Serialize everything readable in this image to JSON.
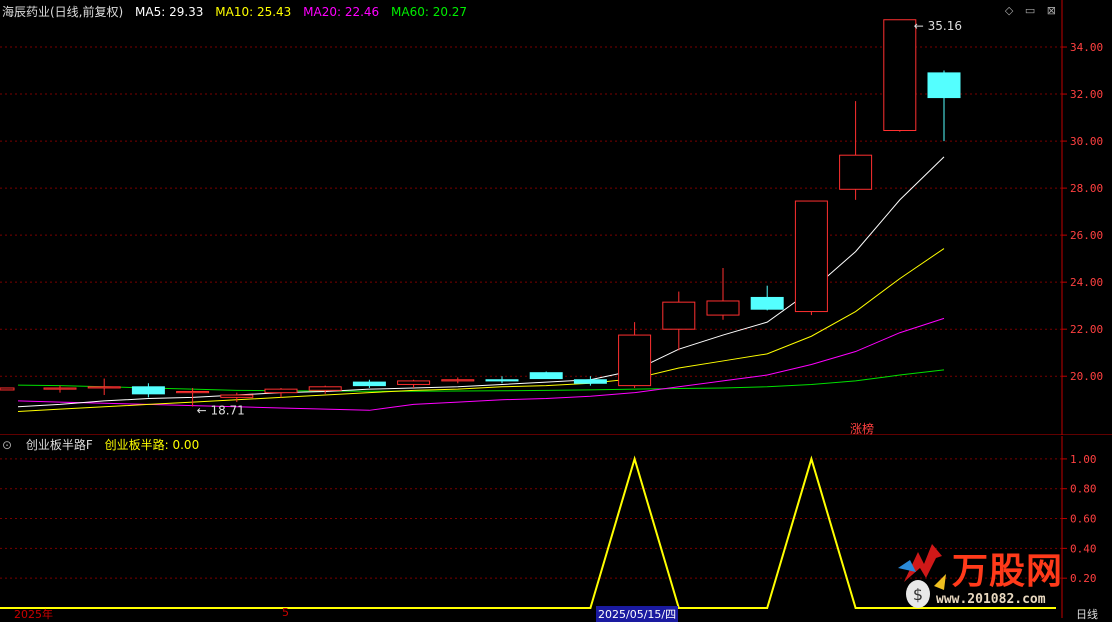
{
  "header": {
    "stock_title": "海辰药业(日线,前复权)",
    "ma": [
      {
        "label": "MA5: 29.33",
        "color": "#ffffff"
      },
      {
        "label": "MA10: 25.43",
        "color": "#ffff00"
      },
      {
        "label": "MA20: 22.46",
        "color": "#ff00ff"
      },
      {
        "label": "MA60: 20.27",
        "color": "#00e000"
      }
    ],
    "icons": [
      "diamond-icon",
      "minimize-icon",
      "close-icon"
    ]
  },
  "indicator": {
    "title": "创业板半路F",
    "value_label": "创业板半路: 0.00",
    "title_color": "#dddddd",
    "value_color": "#ffff00"
  },
  "colors": {
    "up": "#ff3030",
    "down": "#54ffff",
    "grid": "#7a0000",
    "axis": "#c00000",
    "axis_text": "#ff4040",
    "indicator_line": "#ffff00"
  },
  "annotations": {
    "high_label": "35.16",
    "low_label": "18.71",
    "limit_up_tag": "涨榜"
  },
  "bottom": {
    "left_label": "2025年",
    "mid_label": "5",
    "date_label": "2025/05/15/四",
    "right_label": "日线"
  },
  "watermark": {
    "name": "万股网",
    "url": "www.201082.com"
  },
  "chart_data": [
    {
      "type": "candlestick",
      "ylim": [
        17.5,
        36.0
      ],
      "yticks": [
        "20.00",
        "22.00",
        "24.00",
        "26.00",
        "28.00",
        "30.00",
        "32.00",
        "34.00"
      ],
      "ytick_values": [
        20,
        22,
        24,
        26,
        28,
        30,
        32,
        34
      ],
      "candles": [
        {
          "o": 19.45,
          "h": 19.6,
          "l": 19.3,
          "c": 19.5
        },
        {
          "o": 19.5,
          "h": 19.9,
          "l": 19.2,
          "c": 19.55
        },
        {
          "o": 19.55,
          "h": 19.7,
          "l": 19.1,
          "c": 19.25
        },
        {
          "o": 19.3,
          "h": 19.5,
          "l": 18.71,
          "c": 19.35
        },
        {
          "o": 19.1,
          "h": 19.3,
          "l": 18.9,
          "c": 19.2
        },
        {
          "o": 19.3,
          "h": 19.5,
          "l": 19.1,
          "c": 19.45
        },
        {
          "o": 19.4,
          "h": 19.6,
          "l": 19.25,
          "c": 19.55
        },
        {
          "o": 19.75,
          "h": 19.85,
          "l": 19.5,
          "c": 19.6
        },
        {
          "o": 19.65,
          "h": 19.85,
          "l": 19.5,
          "c": 19.8
        },
        {
          "o": 19.8,
          "h": 19.95,
          "l": 19.7,
          "c": 19.85
        },
        {
          "o": 19.85,
          "h": 20.0,
          "l": 19.7,
          "c": 19.8
        },
        {
          "o": 20.15,
          "h": 20.2,
          "l": 19.9,
          "c": 19.9
        },
        {
          "o": 19.85,
          "h": 20.0,
          "l": 19.6,
          "c": 19.7
        },
        {
          "o": 19.6,
          "h": 22.3,
          "l": 19.5,
          "c": 21.75
        },
        {
          "o": 22.0,
          "h": 23.6,
          "l": 21.1,
          "c": 23.15
        },
        {
          "o": 22.6,
          "h": 24.6,
          "l": 22.4,
          "c": 23.2
        },
        {
          "o": 23.35,
          "h": 23.85,
          "l": 22.8,
          "c": 22.85
        },
        {
          "o": 22.75,
          "h": 27.45,
          "l": 22.6,
          "c": 27.45
        },
        {
          "o": 27.95,
          "h": 31.7,
          "l": 27.5,
          "c": 29.4
        },
        {
          "o": 30.45,
          "h": 35.16,
          "l": 30.4,
          "c": 35.16
        },
        {
          "o": 32.9,
          "h": 33.0,
          "l": 30.0,
          "c": 31.85
        }
      ],
      "ma5": [
        18.8,
        18.95,
        19.05,
        19.1,
        19.2,
        19.3,
        19.35,
        19.45,
        19.5,
        19.55,
        19.65,
        19.75,
        19.85,
        20.25,
        21.15,
        21.75,
        22.3,
        23.65,
        25.3,
        27.5,
        29.33
      ],
      "ma10": [
        18.6,
        18.7,
        18.8,
        18.9,
        19.0,
        19.1,
        19.2,
        19.3,
        19.4,
        19.45,
        19.55,
        19.6,
        19.7,
        19.9,
        20.35,
        20.65,
        20.95,
        21.7,
        22.75,
        24.15,
        25.43
      ],
      "ma20": [
        18.9,
        18.85,
        18.8,
        18.75,
        18.7,
        18.65,
        18.6,
        18.55,
        18.8,
        18.9,
        19.0,
        19.05,
        19.15,
        19.3,
        19.55,
        19.8,
        20.05,
        20.5,
        21.05,
        21.85,
        22.46
      ],
      "ma60": [
        19.6,
        19.55,
        19.5,
        19.45,
        19.4,
        19.38,
        19.37,
        19.36,
        19.36,
        19.37,
        19.38,
        19.4,
        19.42,
        19.45,
        19.48,
        19.5,
        19.55,
        19.65,
        19.8,
        20.05,
        20.27
      ],
      "ma_extend_left": {
        "ma5": 18.7,
        "ma10": 18.5,
        "ma20": 18.95,
        "ma60": 19.62
      }
    },
    {
      "type": "line",
      "series_name": "创业板半路",
      "ylim": [
        0,
        1.1
      ],
      "yticks": [
        "0.20",
        "0.40",
        "0.60",
        "0.80",
        "1.00"
      ],
      "ytick_values": [
        0.2,
        0.4,
        0.6,
        0.8,
        1.0
      ],
      "values": [
        0,
        0,
        0,
        0,
        0,
        0,
        0,
        0,
        0,
        0,
        0,
        0,
        0,
        1,
        0,
        0,
        0,
        1,
        0,
        0,
        0
      ]
    }
  ]
}
